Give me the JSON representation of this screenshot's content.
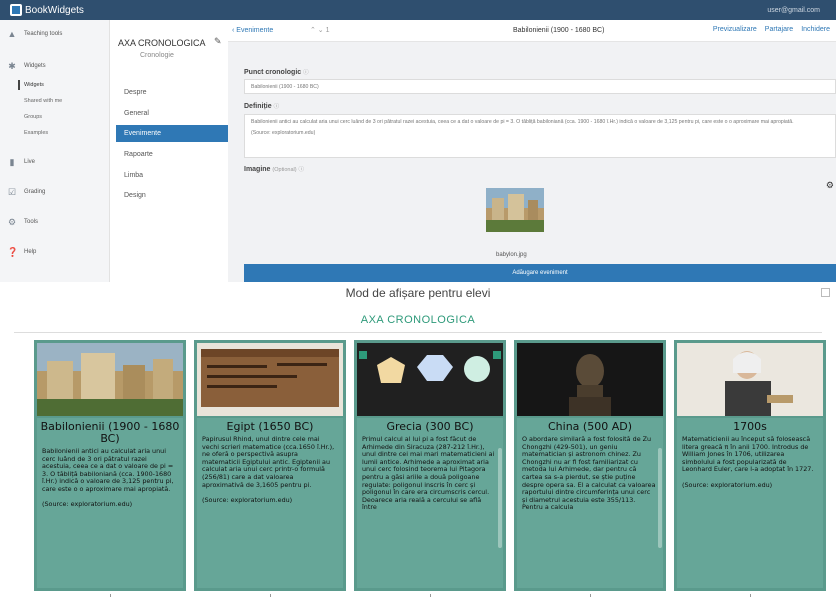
{
  "app": {
    "logo_text": "BookWidgets",
    "user_email": "user@gmail.com",
    "brand_color": "#2f78b5",
    "topbar_color": "#2f4f6f"
  },
  "sidebar": {
    "items": [
      {
        "icon": "graduation-cap-icon",
        "label": "Teaching tools"
      },
      {
        "icon": "widgets-icon",
        "label": "Widgets"
      },
      {
        "icon": "live-icon",
        "label": "Live"
      },
      {
        "icon": "grading-icon",
        "label": "Grading"
      },
      {
        "icon": "tools-icon",
        "label": "Tools"
      },
      {
        "icon": "help-icon",
        "label": "Help"
      }
    ],
    "sub_items": [
      "Widgets",
      "Shared with me",
      "Groups",
      "Examples"
    ]
  },
  "widget": {
    "name": "AXA CRONOLOGICA",
    "type": "Cronologie",
    "menu": [
      "Despre",
      "General",
      "Evenimente",
      "Rapoarte",
      "Limba",
      "Design"
    ],
    "active_menu": "Evenimente"
  },
  "editor": {
    "back_label": "Evenimente",
    "nav_counter": "1",
    "title": "Babilonienii (1900 - 1680 BC)",
    "actions": [
      "Previzualizare",
      "Partajare",
      "Inchidere"
    ],
    "point_label": "Punct cronologic",
    "point_value": "Babilonienii (1900 - 1680 BC)",
    "definition_label": "Definiție",
    "definition_text": "Babilonienii antici au calculat aria unui cerc luând de 3 ori pătratul razei acestuia, ceea ce a dat o valoare de pi = 3. O tăbliță babiloniană (cca. 1900 - 1680 î.Hr.) indică o valoare de 3,125 pentru pi, care este o o aproximare mai apropiată.",
    "definition_source": "(Source: exploratorium.edu)",
    "image_label": "Imagine",
    "image_hint": "(Optional)",
    "image_file": "babylon.jpg",
    "add_button": "Adăugare eveniment"
  },
  "preview": {
    "title": "Mod de afișare pentru elevi",
    "timeline_title": "AXA CRONOLOGICA",
    "timeline_color": "#2e9a7a",
    "card_color": "#66a698",
    "cards": [
      {
        "title": "Babilonienii (1900 - 1680 BC)",
        "image": "babylon-city-painting",
        "text": "Babilonienii antici au calculat aria unui cerc luând de 3 ori pătratul razei acestuia, ceea ce a dat o valoare de pi = 3. O tăbliță babiloniană (cca. 1900-1680 î.Hr.) indică o valoare de 3,125 pentru pi, care este o o aproximare mai apropiată.\n\n(Source: exploratorium.edu)"
      },
      {
        "title": "Egipt (1650 BC)",
        "image": "rhind-papyrus",
        "text": "Papirusul Rhind, unul dintre cele mai vechi scrieri matematice (cca.1650 î.Hr.), ne oferă o perspectivă asupra matematicii Egiptului antic. Egiptenii au calculat aria unui cerc printr-o formulă (256/81) care a dat valoarea aproximativă de 3,1605 pentru pi.\n\n(Source: exploratorium.edu)"
      },
      {
        "title": "Grecia (300 BC)",
        "image": "polygons",
        "text": "Primul calcul al lui pi a fost făcut de Arhimede din Siracuza (287-212 î.Hr.), unul dintre cei mai mari matematicieni ai lumii antice. Arhimede a aproximat aria unui cerc folosind teorema lui Pitagora pentru a găsi ariile a două poligoane regulate: poligonul inscris în cerc și poligonul în care era circumscris cercul. Deoarece aria reală a cercului se află între"
      },
      {
        "title": "China (500 AD)",
        "image": "bust-sculpture",
        "text": "O abordare similară a fost folosită de Zu Chongzhi (429-501), un geniu matematician și astronom chinez. Zu Chongzhi nu ar fi fost familiarizat cu metoda lui Arhimede, dar pentru că cartea sa s-a pierdut, se știe puține despre opera sa. El a calculat ca valoarea raportului dintre circumferința unui cerc și diametrul acestuia este 355/113. Pentru a calcula"
      },
      {
        "title": "1700s",
        "image": "euler-portrait",
        "text": "Matematicienii au început să folosească litera greacă π în anii 1700. Introdus de William Jones în 1706, utilizarea simbolului a fost popularizată de Leonhard Euler, care l-a adoptat în 1727.\n\n(Source: exploratorium.edu)"
      }
    ]
  }
}
